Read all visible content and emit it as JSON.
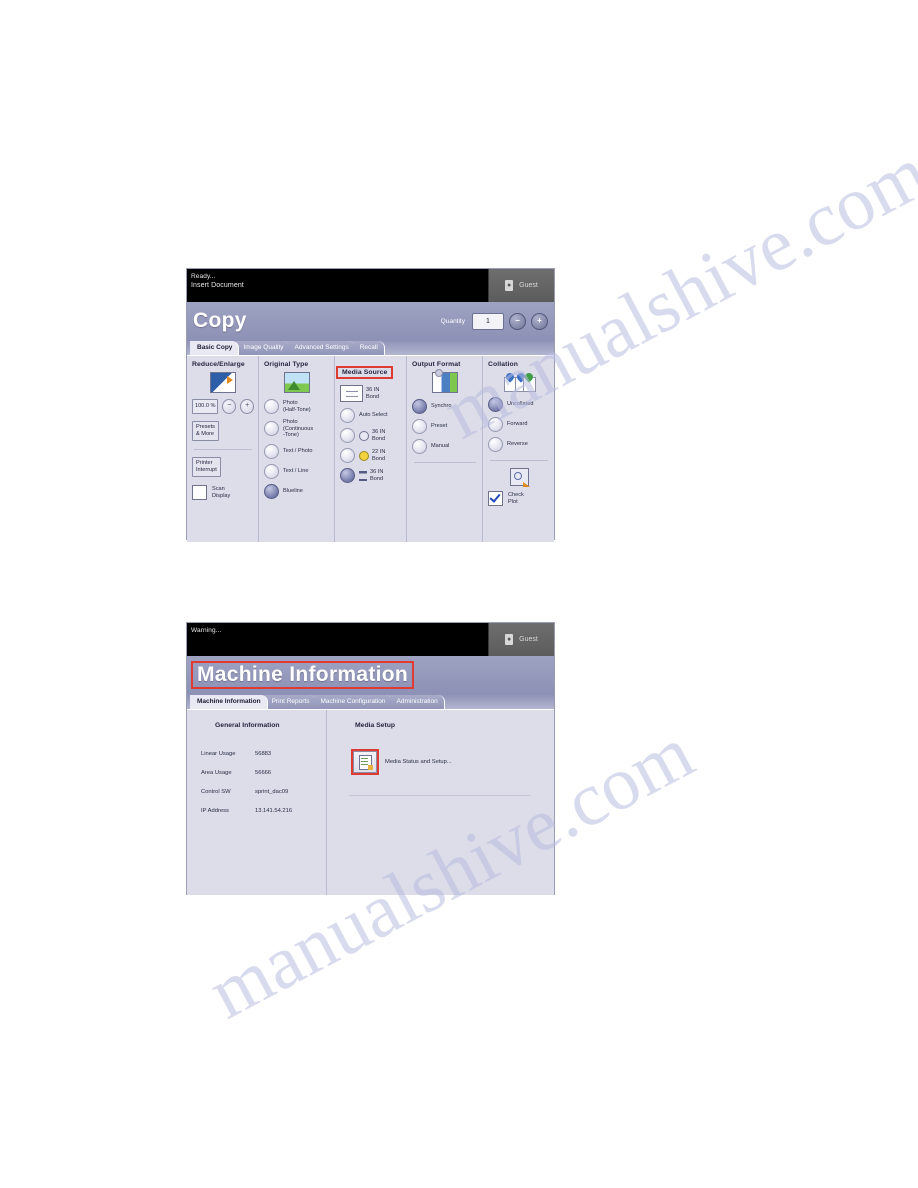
{
  "watermark": {
    "line_a": "manualshive.com",
    "line_b": "manualshive.com"
  },
  "copy_screen": {
    "status": {
      "line1": "Ready...",
      "line2": "Insert Document"
    },
    "user_button": {
      "label": "Guest",
      "icon": "user-badge-icon"
    },
    "title": "Copy",
    "quantity": {
      "label": "Quantity",
      "value": "1",
      "decrement": "−",
      "increment": "+"
    },
    "tabs": [
      {
        "label": "Basic Copy",
        "active": true
      },
      {
        "label": "Image Quality",
        "active": false
      },
      {
        "label": "Advanced Settings",
        "active": false
      },
      {
        "label": "Recall",
        "active": false
      }
    ],
    "columns": {
      "reduce_enlarge": {
        "heading": "Reduce/Enlarge",
        "icon": "reduce-enlarge-icon",
        "percent": "100.0 %",
        "decrement": "−",
        "increment": "+",
        "presets_button": "Presets\n& More",
        "presets_line1": "Presets",
        "presets_line2": "& More",
        "printer_interrupt_line1": "Printer",
        "printer_interrupt_line2": "Interrupt",
        "scan_display_line1": "Scan",
        "scan_display_line2": "Display",
        "scan_display_checked": false
      },
      "original_type": {
        "heading": "Original Type",
        "icon": "photo-icon",
        "options": [
          {
            "label": "Photo\n(Half-Tone)",
            "l1": "Photo",
            "l2": "(Half-Tone)",
            "l3": "",
            "selected": false
          },
          {
            "label": "Photo (Continuous-Tone)",
            "l1": "Photo",
            "l2": "(Continuous",
            "l3": "-Tone)",
            "selected": false
          },
          {
            "label": "Text / Photo",
            "l1": "Text / Photo",
            "l2": "",
            "l3": "",
            "selected": false
          },
          {
            "label": "Text / Line",
            "l1": "Text / Line",
            "l2": "",
            "l3": "",
            "selected": false
          },
          {
            "label": "Blueline",
            "l1": "Blueline",
            "l2": "",
            "l3": "",
            "selected": true
          }
        ]
      },
      "media_source": {
        "heading": "Media Source",
        "highlighted": true,
        "current_media_line1": "36 IN",
        "current_media_line2": "Bond",
        "icon": "media-roll-icon",
        "options": [
          {
            "l1": "Auto Select",
            "l2": "",
            "icon": "",
            "selected": false
          },
          {
            "l1": "36 IN",
            "l2": "Bond",
            "icon": "roll-icon",
            "selected": false
          },
          {
            "l1": "22 IN",
            "l2": "Bond",
            "icon": "roll-yellow-icon",
            "selected": false
          },
          {
            "l1": "36 IN",
            "l2": "Bond",
            "icon": "cut-sheet-icon",
            "selected": true
          }
        ]
      },
      "output_format": {
        "heading": "Output Format",
        "icon": "output-format-icon",
        "options": [
          {
            "label": "Synchro",
            "selected": true
          },
          {
            "label": "Preset",
            "selected": false
          },
          {
            "label": "Manual",
            "selected": false
          }
        ]
      },
      "collation": {
        "heading": "Collation",
        "icon": "collation-pins-icon",
        "options": [
          {
            "label": "Uncollated",
            "selected": true
          },
          {
            "label": "Forward",
            "selected": false
          },
          {
            "label": "Reverse",
            "selected": false
          }
        ],
        "check_plot_icon": "check-plot-icon",
        "check_plot_line1": "Check",
        "check_plot_line2": "Plot",
        "check_plot_checked": true
      }
    }
  },
  "info_screen": {
    "status": {
      "line1": "Warning...",
      "line2": ""
    },
    "user_button": {
      "label": "Guest",
      "icon": "user-badge-icon"
    },
    "title": "Machine Information",
    "title_highlighted": true,
    "tabs": [
      {
        "label": "Machine Information",
        "active": true
      },
      {
        "label": "Print Reports",
        "active": false
      },
      {
        "label": "Machine Configuration",
        "active": false
      },
      {
        "label": "Administration",
        "active": false
      }
    ],
    "general_information": {
      "heading": "General Information",
      "rows": [
        {
          "key": "Linear Usage",
          "value": "56883"
        },
        {
          "key": "Area Usage",
          "value": "56666"
        },
        {
          "key": "Control SW",
          "value": "sprint_dac09"
        },
        {
          "key": "IP Address",
          "value": "13.141.54.216"
        }
      ]
    },
    "media_setup": {
      "heading": "Media Setup",
      "button_label": "Media Status and Setup...",
      "button_icon": "media-status-icon",
      "highlighted": true
    }
  }
}
